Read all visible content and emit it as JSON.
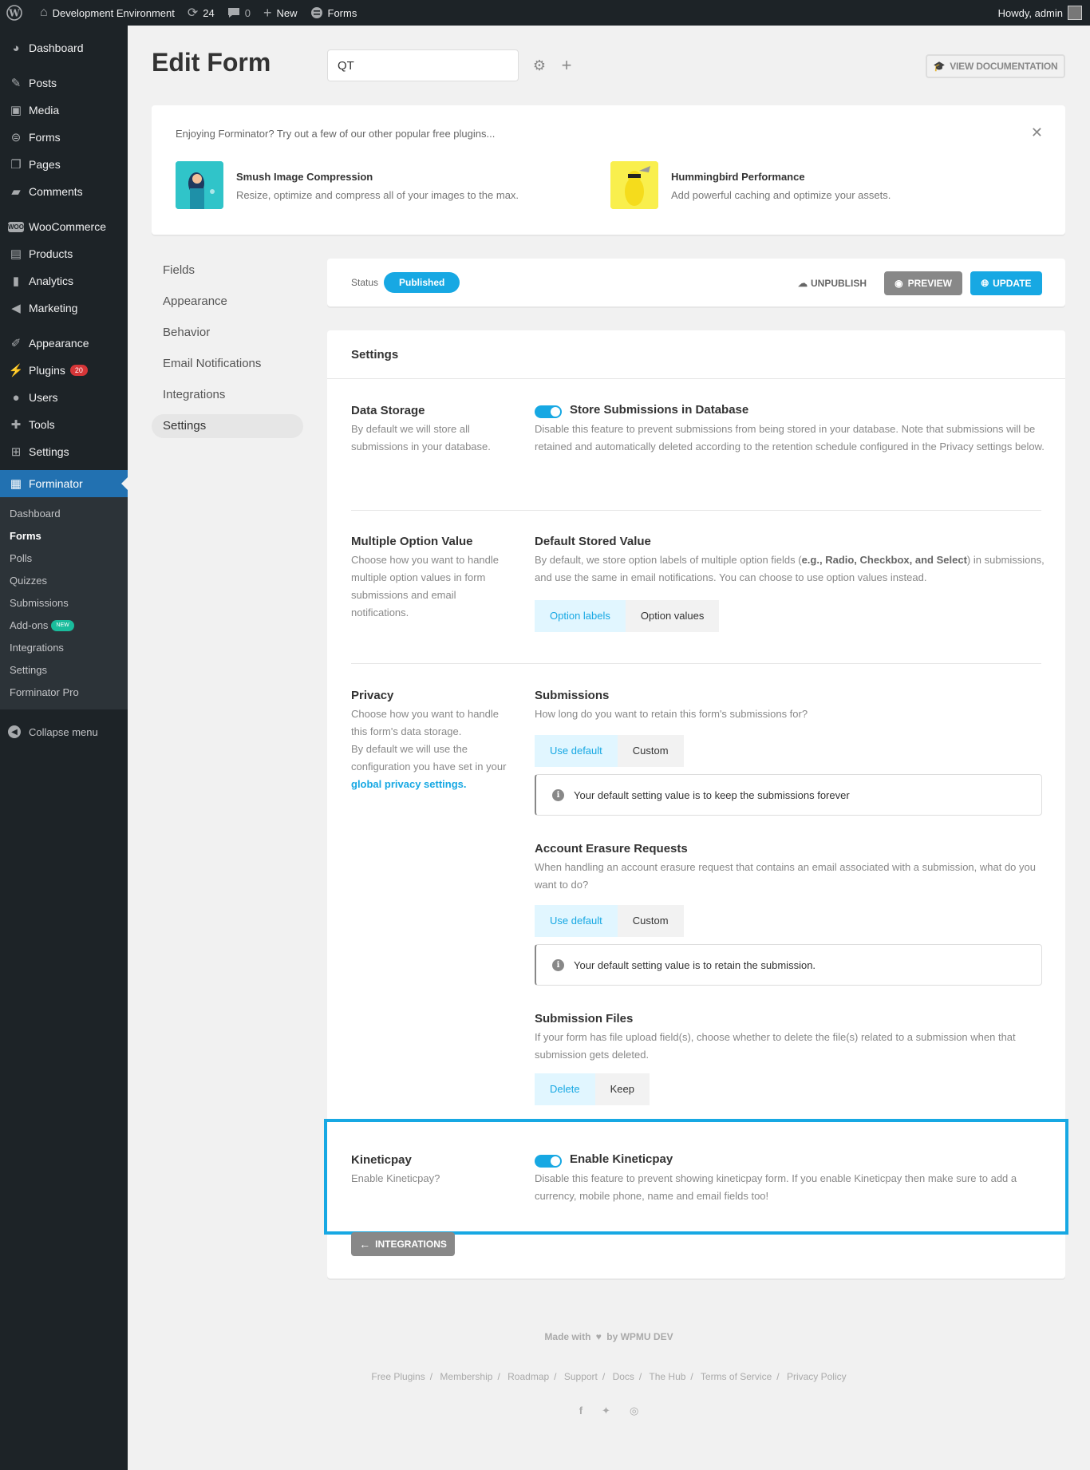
{
  "adminbar": {
    "site_name": "Development Environment",
    "updates_count": "24",
    "comments_count": "0",
    "new_label": "New",
    "forms_label": "Forms",
    "howdy": "Howdy, admin"
  },
  "sidebar": {
    "items": [
      {
        "label": "Dashboard",
        "icon": "dashboard-icon"
      },
      {
        "label": "Posts",
        "icon": "pin-icon"
      },
      {
        "label": "Media",
        "icon": "media-icon"
      },
      {
        "label": "Forms",
        "icon": "forms-icon"
      },
      {
        "label": "Pages",
        "icon": "page-icon"
      },
      {
        "label": "Comments",
        "icon": "comment-icon"
      },
      {
        "label": "WooCommerce",
        "icon": "woo-icon"
      },
      {
        "label": "Products",
        "icon": "archive-icon"
      },
      {
        "label": "Analytics",
        "icon": "chart-icon"
      },
      {
        "label": "Marketing",
        "icon": "megaphone-icon"
      },
      {
        "label": "Appearance",
        "icon": "brush-icon"
      },
      {
        "label": "Plugins",
        "icon": "plugin-icon",
        "badge": "20"
      },
      {
        "label": "Users",
        "icon": "user-icon"
      },
      {
        "label": "Tools",
        "icon": "wrench-icon"
      },
      {
        "label": "Settings",
        "icon": "settings-icon"
      },
      {
        "label": "Forminator",
        "icon": "clipboard-icon"
      }
    ],
    "submenu": [
      "Dashboard",
      "Forms",
      "Polls",
      "Quizzes",
      "Submissions",
      "Add-ons",
      "Integrations",
      "Settings",
      "Forminator Pro"
    ],
    "new_badge": "NEW",
    "collapse": "Collapse menu"
  },
  "header": {
    "title": "Edit Form",
    "form_name": "QT",
    "doc_button": "VIEW DOCUMENTATION"
  },
  "promo": {
    "intro": "Enjoying Forminator? Try out a few of our other popular free plugins...",
    "plugins": [
      {
        "name": "Smush Image Compression",
        "desc": "Resize, optimize and compress all of your images to the max."
      },
      {
        "name": "Hummingbird Performance",
        "desc": "Add powerful caching and optimize your assets."
      }
    ]
  },
  "nav": [
    "Fields",
    "Appearance",
    "Behavior",
    "Email Notifications",
    "Integrations",
    "Settings"
  ],
  "statusbar": {
    "label": "Status",
    "status": "Published",
    "unpublish": "UNPUBLISH",
    "preview": "PREVIEW",
    "update": "UPDATE"
  },
  "settings": {
    "title": "Settings",
    "data_storage": {
      "label": "Data Storage",
      "desc": "By default we will store all submissions in your database.",
      "toggle_label": "Store Submissions in Database",
      "toggle_desc": "Disable this feature to prevent submissions from being stored in your database. Note that submissions will be retained and automatically deleted according to the retention schedule configured in the Privacy settings below."
    },
    "multiple_option": {
      "label": "Multiple Option Value",
      "desc": "Choose how you want to handle multiple option values in form submissions and email notifications.",
      "sub_label": "Default Stored Value",
      "sub_desc_1": "By default, we store option labels of multiple option fields (",
      "sub_desc_bold": "e.g., Radio, Checkbox, and Select",
      "sub_desc_2": ") in submissions, and use the same in email notifications. You can choose to use option values instead.",
      "tabs": [
        "Option labels",
        "Option values"
      ]
    },
    "privacy": {
      "label": "Privacy",
      "desc_1": "Choose how you want to handle this form's data storage.",
      "desc_2": "By default we will use the configuration you have set in your",
      "link": "global privacy settings.",
      "submissions": {
        "label": "Submissions",
        "desc": "How long do you want to retain this form's submissions for?",
        "tabs": [
          "Use default",
          "Custom"
        ],
        "notice": "Your default setting value is to keep the submissions forever"
      },
      "erasure": {
        "label": "Account Erasure Requests",
        "desc": "When handling an account erasure request that contains an email associated with a submission, what do you want to do?",
        "tabs": [
          "Use default",
          "Custom"
        ],
        "notice": "Your default setting value is to retain the submission."
      },
      "files": {
        "label": "Submission Files",
        "desc": "If your form has file upload field(s), choose whether to delete the file(s) related to a submission when that submission gets deleted.",
        "tabs": [
          "Delete",
          "Keep"
        ]
      }
    },
    "kineticpay": {
      "label": "Kineticpay",
      "desc": "Enable Kineticpay?",
      "toggle_label": "Enable Kineticpay",
      "toggle_desc": "Disable this feature to prevent showing kineticpay form. If you enable Kineticpay then make sure to add a currency, mobile phone, name and email fields too!"
    },
    "back_button": "INTEGRATIONS"
  },
  "footer": {
    "made_with": "Made with",
    "by": "by WPMU DEV",
    "links": [
      "Free Plugins",
      "Membership",
      "Roadmap",
      "Support",
      "Docs",
      "The Hub",
      "Terms of Service",
      "Privacy Policy"
    ],
    "social": [
      "facebook-icon",
      "twitter-icon",
      "instagram-icon"
    ]
  },
  "colors": {
    "accent": "#17a8e3",
    "sidebar_bg": "#1d2327",
    "wp_blue": "#2271b1"
  }
}
